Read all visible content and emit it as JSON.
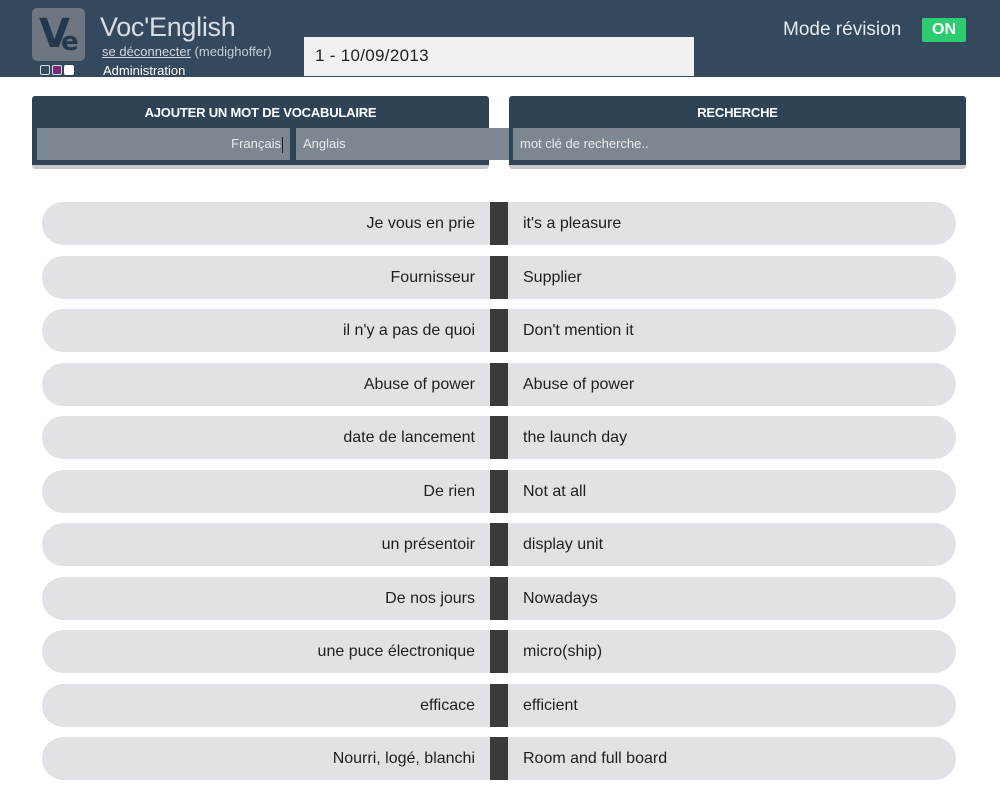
{
  "header": {
    "logo_text_v": "V",
    "logo_text_e": "e",
    "app_title": "Voc'English",
    "logout_label": "se déconnecter",
    "username": "(medighoffer)",
    "admin_label": "Administration",
    "list_value": "1 - 10/09/2013",
    "mode_label": "Mode révision",
    "mode_state": "ON"
  },
  "add_panel": {
    "title": "AJOUTER UN MOT DE VOCABULAIRE",
    "french_placeholder": "Français",
    "english_placeholder": "Anglais"
  },
  "search_panel": {
    "title": "RECHERCHE",
    "placeholder": "mot clé de recherche.."
  },
  "vocabulary": [
    {
      "fr": "Je vous en prie",
      "en": "it's a pleasure"
    },
    {
      "fr": "Fournisseur",
      "en": "Supplier"
    },
    {
      "fr": "il n'y a pas de quoi",
      "en": "Don't mention it"
    },
    {
      "fr": "Abuse of power",
      "en": "Abuse of power"
    },
    {
      "fr": "date de lancement",
      "en": "the launch day"
    },
    {
      "fr": "De rien",
      "en": "Not at all"
    },
    {
      "fr": "un présentoir",
      "en": "display unit"
    },
    {
      "fr": "De nos jours",
      "en": "Nowadays"
    },
    {
      "fr": "une puce électronique",
      "en": "micro(ship)"
    },
    {
      "fr": "efficace",
      "en": "efficient"
    },
    {
      "fr": "Nourri, logé, blanchi",
      "en": "Room and full board"
    }
  ],
  "colors": {
    "header_bg": "#35495e",
    "toggle_on": "#2ecc71",
    "row_bg": "#e2e1e6",
    "separator": "#3a3a3a"
  }
}
